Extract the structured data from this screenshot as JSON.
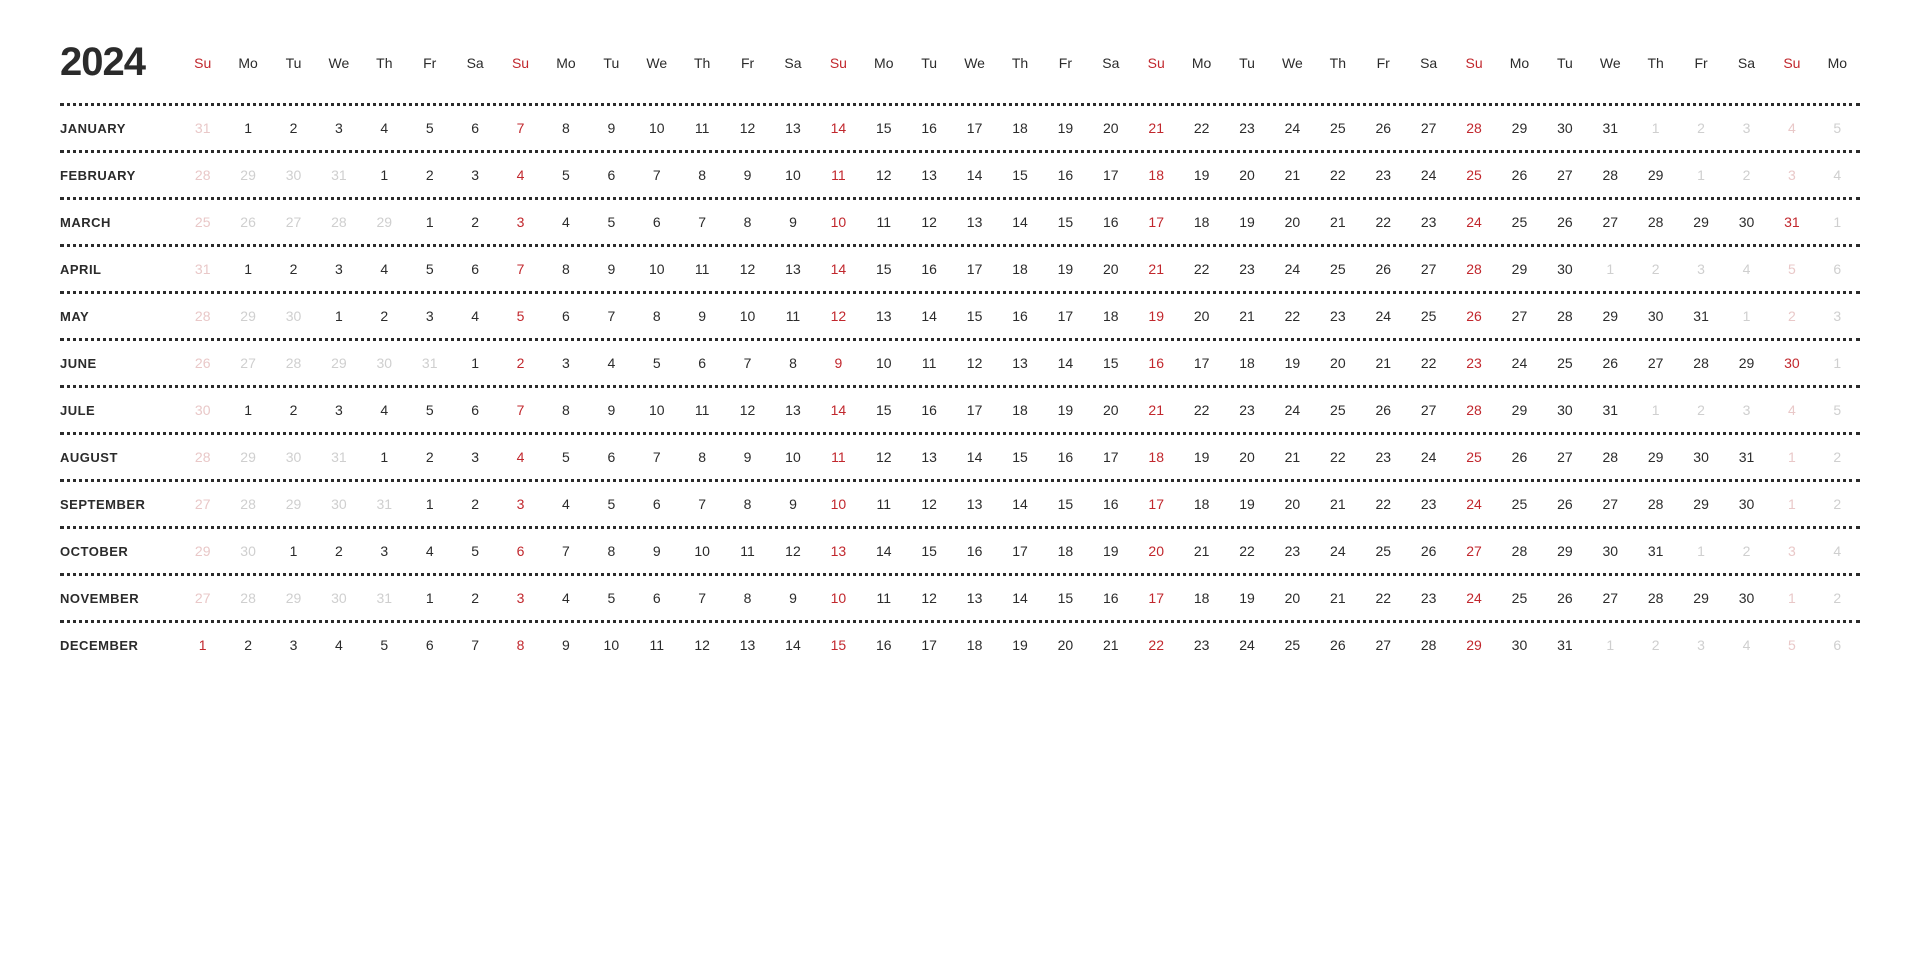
{
  "year": "2024",
  "weekday_pattern": [
    "Su",
    "Mo",
    "Tu",
    "We",
    "Th",
    "Fr",
    "Sa"
  ],
  "columns": 37,
  "months": [
    {
      "name": "JANUARY",
      "days": [
        {
          "n": 31,
          "f": 1
        },
        {
          "n": 1
        },
        {
          "n": 2
        },
        {
          "n": 3
        },
        {
          "n": 4
        },
        {
          "n": 5
        },
        {
          "n": 6
        },
        {
          "n": 7
        },
        {
          "n": 8
        },
        {
          "n": 9
        },
        {
          "n": 10
        },
        {
          "n": 11
        },
        {
          "n": 12
        },
        {
          "n": 13
        },
        {
          "n": 14
        },
        {
          "n": 15
        },
        {
          "n": 16
        },
        {
          "n": 17
        },
        {
          "n": 18
        },
        {
          "n": 19
        },
        {
          "n": 20
        },
        {
          "n": 21
        },
        {
          "n": 22
        },
        {
          "n": 23
        },
        {
          "n": 24
        },
        {
          "n": 25
        },
        {
          "n": 26
        },
        {
          "n": 27
        },
        {
          "n": 28
        },
        {
          "n": 29
        },
        {
          "n": 30
        },
        {
          "n": 31
        },
        {
          "n": 1,
          "f": 1
        },
        {
          "n": 2,
          "f": 1
        },
        {
          "n": 3,
          "f": 1
        },
        {
          "n": 4,
          "f": 1
        },
        {
          "n": 5,
          "f": 1
        }
      ]
    },
    {
      "name": "FEBRUARY",
      "days": [
        {
          "n": 28,
          "f": 1
        },
        {
          "n": 29,
          "f": 1
        },
        {
          "n": 30,
          "f": 1
        },
        {
          "n": 31,
          "f": 1
        },
        {
          "n": 1
        },
        {
          "n": 2
        },
        {
          "n": 3
        },
        {
          "n": 4
        },
        {
          "n": 5
        },
        {
          "n": 6
        },
        {
          "n": 7
        },
        {
          "n": 8
        },
        {
          "n": 9
        },
        {
          "n": 10
        },
        {
          "n": 11
        },
        {
          "n": 12
        },
        {
          "n": 13
        },
        {
          "n": 14
        },
        {
          "n": 15
        },
        {
          "n": 16
        },
        {
          "n": 17
        },
        {
          "n": 18
        },
        {
          "n": 19
        },
        {
          "n": 20
        },
        {
          "n": 21
        },
        {
          "n": 22
        },
        {
          "n": 23
        },
        {
          "n": 24
        },
        {
          "n": 25
        },
        {
          "n": 26
        },
        {
          "n": 27
        },
        {
          "n": 28
        },
        {
          "n": 29
        },
        {
          "n": 1,
          "f": 1
        },
        {
          "n": 2,
          "f": 1
        },
        {
          "n": 3,
          "f": 1
        },
        {
          "n": 4,
          "f": 1
        }
      ]
    },
    {
      "name": "MARCH",
      "days": [
        {
          "n": 25,
          "f": 1
        },
        {
          "n": 26,
          "f": 1
        },
        {
          "n": 27,
          "f": 1
        },
        {
          "n": 28,
          "f": 1
        },
        {
          "n": 29,
          "f": 1
        },
        {
          "n": 1
        },
        {
          "n": 2
        },
        {
          "n": 3
        },
        {
          "n": 4
        },
        {
          "n": 5
        },
        {
          "n": 6
        },
        {
          "n": 7
        },
        {
          "n": 8
        },
        {
          "n": 9
        },
        {
          "n": 10
        },
        {
          "n": 11
        },
        {
          "n": 12
        },
        {
          "n": 13
        },
        {
          "n": 14
        },
        {
          "n": 15
        },
        {
          "n": 16
        },
        {
          "n": 17
        },
        {
          "n": 18
        },
        {
          "n": 19
        },
        {
          "n": 20
        },
        {
          "n": 21
        },
        {
          "n": 22
        },
        {
          "n": 23
        },
        {
          "n": 24
        },
        {
          "n": 25
        },
        {
          "n": 26
        },
        {
          "n": 27
        },
        {
          "n": 28
        },
        {
          "n": 29
        },
        {
          "n": 30
        },
        {
          "n": 31
        },
        {
          "n": 1,
          "f": 1
        }
      ]
    },
    {
      "name": "APRIL",
      "days": [
        {
          "n": 31,
          "f": 1
        },
        {
          "n": 1
        },
        {
          "n": 2
        },
        {
          "n": 3
        },
        {
          "n": 4
        },
        {
          "n": 5
        },
        {
          "n": 6
        },
        {
          "n": 7
        },
        {
          "n": 8
        },
        {
          "n": 9
        },
        {
          "n": 10
        },
        {
          "n": 11
        },
        {
          "n": 12
        },
        {
          "n": 13
        },
        {
          "n": 14
        },
        {
          "n": 15
        },
        {
          "n": 16
        },
        {
          "n": 17
        },
        {
          "n": 18
        },
        {
          "n": 19
        },
        {
          "n": 20
        },
        {
          "n": 21
        },
        {
          "n": 22
        },
        {
          "n": 23
        },
        {
          "n": 24
        },
        {
          "n": 25
        },
        {
          "n": 26
        },
        {
          "n": 27
        },
        {
          "n": 28
        },
        {
          "n": 29
        },
        {
          "n": 30
        },
        {
          "n": 1,
          "f": 1
        },
        {
          "n": 2,
          "f": 1
        },
        {
          "n": 3,
          "f": 1
        },
        {
          "n": 4,
          "f": 1
        },
        {
          "n": 5,
          "f": 1
        },
        {
          "n": 6,
          "f": 1
        }
      ]
    },
    {
      "name": "MAY",
      "days": [
        {
          "n": 28,
          "f": 1
        },
        {
          "n": 29,
          "f": 1
        },
        {
          "n": 30,
          "f": 1
        },
        {
          "n": 1
        },
        {
          "n": 2
        },
        {
          "n": 3
        },
        {
          "n": 4
        },
        {
          "n": 5
        },
        {
          "n": 6
        },
        {
          "n": 7
        },
        {
          "n": 8
        },
        {
          "n": 9
        },
        {
          "n": 10
        },
        {
          "n": 11
        },
        {
          "n": 12
        },
        {
          "n": 13
        },
        {
          "n": 14
        },
        {
          "n": 15
        },
        {
          "n": 16
        },
        {
          "n": 17
        },
        {
          "n": 18
        },
        {
          "n": 19
        },
        {
          "n": 20
        },
        {
          "n": 21
        },
        {
          "n": 22
        },
        {
          "n": 23
        },
        {
          "n": 24
        },
        {
          "n": 25
        },
        {
          "n": 26
        },
        {
          "n": 27
        },
        {
          "n": 28
        },
        {
          "n": 29
        },
        {
          "n": 30
        },
        {
          "n": 31
        },
        {
          "n": 1,
          "f": 1
        },
        {
          "n": 2,
          "f": 1
        },
        {
          "n": 3,
          "f": 1
        }
      ]
    },
    {
      "name": "JUNE",
      "days": [
        {
          "n": 26,
          "f": 1
        },
        {
          "n": 27,
          "f": 1
        },
        {
          "n": 28,
          "f": 1
        },
        {
          "n": 29,
          "f": 1
        },
        {
          "n": 30,
          "f": 1
        },
        {
          "n": 31,
          "f": 1
        },
        {
          "n": 1
        },
        {
          "n": 2
        },
        {
          "n": 3
        },
        {
          "n": 4
        },
        {
          "n": 5
        },
        {
          "n": 6
        },
        {
          "n": 7
        },
        {
          "n": 8
        },
        {
          "n": 9
        },
        {
          "n": 10
        },
        {
          "n": 11
        },
        {
          "n": 12
        },
        {
          "n": 13
        },
        {
          "n": 14
        },
        {
          "n": 15
        },
        {
          "n": 16
        },
        {
          "n": 17
        },
        {
          "n": 18
        },
        {
          "n": 19
        },
        {
          "n": 20
        },
        {
          "n": 21
        },
        {
          "n": 22
        },
        {
          "n": 23
        },
        {
          "n": 24
        },
        {
          "n": 25
        },
        {
          "n": 26
        },
        {
          "n": 27
        },
        {
          "n": 28
        },
        {
          "n": 29
        },
        {
          "n": 30
        },
        {
          "n": 1,
          "f": 1
        }
      ]
    },
    {
      "name": "JULE",
      "days": [
        {
          "n": 30,
          "f": 1
        },
        {
          "n": 1
        },
        {
          "n": 2
        },
        {
          "n": 3
        },
        {
          "n": 4
        },
        {
          "n": 5
        },
        {
          "n": 6
        },
        {
          "n": 7
        },
        {
          "n": 8
        },
        {
          "n": 9
        },
        {
          "n": 10
        },
        {
          "n": 11
        },
        {
          "n": 12
        },
        {
          "n": 13
        },
        {
          "n": 14
        },
        {
          "n": 15
        },
        {
          "n": 16
        },
        {
          "n": 17
        },
        {
          "n": 18
        },
        {
          "n": 19
        },
        {
          "n": 20
        },
        {
          "n": 21
        },
        {
          "n": 22
        },
        {
          "n": 23
        },
        {
          "n": 24
        },
        {
          "n": 25
        },
        {
          "n": 26
        },
        {
          "n": 27
        },
        {
          "n": 28
        },
        {
          "n": 29
        },
        {
          "n": 30
        },
        {
          "n": 31
        },
        {
          "n": 1,
          "f": 1
        },
        {
          "n": 2,
          "f": 1
        },
        {
          "n": 3,
          "f": 1
        },
        {
          "n": 4,
          "f": 1
        },
        {
          "n": 5,
          "f": 1
        }
      ]
    },
    {
      "name": "AUGUST",
      "days": [
        {
          "n": 28,
          "f": 1
        },
        {
          "n": 29,
          "f": 1
        },
        {
          "n": 30,
          "f": 1
        },
        {
          "n": 31,
          "f": 1
        },
        {
          "n": 1
        },
        {
          "n": 2
        },
        {
          "n": 3
        },
        {
          "n": 4
        },
        {
          "n": 5
        },
        {
          "n": 6
        },
        {
          "n": 7
        },
        {
          "n": 8
        },
        {
          "n": 9
        },
        {
          "n": 10
        },
        {
          "n": 11
        },
        {
          "n": 12
        },
        {
          "n": 13
        },
        {
          "n": 14
        },
        {
          "n": 15
        },
        {
          "n": 16
        },
        {
          "n": 17
        },
        {
          "n": 18
        },
        {
          "n": 19
        },
        {
          "n": 20
        },
        {
          "n": 21
        },
        {
          "n": 22
        },
        {
          "n": 23
        },
        {
          "n": 24
        },
        {
          "n": 25
        },
        {
          "n": 26
        },
        {
          "n": 27
        },
        {
          "n": 28
        },
        {
          "n": 29
        },
        {
          "n": 30
        },
        {
          "n": 31
        },
        {
          "n": 1,
          "f": 1
        },
        {
          "n": 2,
          "f": 1
        }
      ]
    },
    {
      "name": "SEPTEMBER",
      "days": [
        {
          "n": 27,
          "f": 1
        },
        {
          "n": 28,
          "f": 1
        },
        {
          "n": 29,
          "f": 1
        },
        {
          "n": 30,
          "f": 1
        },
        {
          "n": 31,
          "f": 1
        },
        {
          "n": 1
        },
        {
          "n": 2
        },
        {
          "n": 3
        },
        {
          "n": 4
        },
        {
          "n": 5
        },
        {
          "n": 6
        },
        {
          "n": 7
        },
        {
          "n": 8
        },
        {
          "n": 9
        },
        {
          "n": 10
        },
        {
          "n": 11
        },
        {
          "n": 12
        },
        {
          "n": 13
        },
        {
          "n": 14
        },
        {
          "n": 15
        },
        {
          "n": 16
        },
        {
          "n": 17
        },
        {
          "n": 18
        },
        {
          "n": 19
        },
        {
          "n": 20
        },
        {
          "n": 21
        },
        {
          "n": 22
        },
        {
          "n": 23
        },
        {
          "n": 24
        },
        {
          "n": 25
        },
        {
          "n": 26
        },
        {
          "n": 27
        },
        {
          "n": 28
        },
        {
          "n": 29
        },
        {
          "n": 30
        },
        {
          "n": 1,
          "f": 1
        },
        {
          "n": 2,
          "f": 1
        }
      ]
    },
    {
      "name": "OCTOBER",
      "days": [
        {
          "n": 29,
          "f": 1
        },
        {
          "n": 30,
          "f": 1
        },
        {
          "n": 1
        },
        {
          "n": 2
        },
        {
          "n": 3
        },
        {
          "n": 4
        },
        {
          "n": 5
        },
        {
          "n": 6
        },
        {
          "n": 7
        },
        {
          "n": 8
        },
        {
          "n": 9
        },
        {
          "n": 10
        },
        {
          "n": 11
        },
        {
          "n": 12
        },
        {
          "n": 13
        },
        {
          "n": 14
        },
        {
          "n": 15
        },
        {
          "n": 16
        },
        {
          "n": 17
        },
        {
          "n": 18
        },
        {
          "n": 19
        },
        {
          "n": 20
        },
        {
          "n": 21
        },
        {
          "n": 22
        },
        {
          "n": 23
        },
        {
          "n": 24
        },
        {
          "n": 25
        },
        {
          "n": 26
        },
        {
          "n": 27
        },
        {
          "n": 28
        },
        {
          "n": 29
        },
        {
          "n": 30
        },
        {
          "n": 31
        },
        {
          "n": 1,
          "f": 1
        },
        {
          "n": 2,
          "f": 1
        },
        {
          "n": 3,
          "f": 1
        },
        {
          "n": 4,
          "f": 1
        }
      ]
    },
    {
      "name": "NOVEMBER",
      "days": [
        {
          "n": 27,
          "f": 1
        },
        {
          "n": 28,
          "f": 1
        },
        {
          "n": 29,
          "f": 1
        },
        {
          "n": 30,
          "f": 1
        },
        {
          "n": 31,
          "f": 1
        },
        {
          "n": 1
        },
        {
          "n": 2
        },
        {
          "n": 3
        },
        {
          "n": 4
        },
        {
          "n": 5
        },
        {
          "n": 6
        },
        {
          "n": 7
        },
        {
          "n": 8
        },
        {
          "n": 9
        },
        {
          "n": 10
        },
        {
          "n": 11
        },
        {
          "n": 12
        },
        {
          "n": 13
        },
        {
          "n": 14
        },
        {
          "n": 15
        },
        {
          "n": 16
        },
        {
          "n": 17
        },
        {
          "n": 18
        },
        {
          "n": 19
        },
        {
          "n": 20
        },
        {
          "n": 21
        },
        {
          "n": 22
        },
        {
          "n": 23
        },
        {
          "n": 24
        },
        {
          "n": 25
        },
        {
          "n": 26
        },
        {
          "n": 27
        },
        {
          "n": 28
        },
        {
          "n": 29
        },
        {
          "n": 30
        },
        {
          "n": 1,
          "f": 1
        },
        {
          "n": 2,
          "f": 1
        }
      ]
    },
    {
      "name": "DECEMBER",
      "days": [
        {
          "n": 1
        },
        {
          "n": 2
        },
        {
          "n": 3
        },
        {
          "n": 4
        },
        {
          "n": 5
        },
        {
          "n": 6
        },
        {
          "n": 7
        },
        {
          "n": 8
        },
        {
          "n": 9
        },
        {
          "n": 10
        },
        {
          "n": 11
        },
        {
          "n": 12
        },
        {
          "n": 13
        },
        {
          "n": 14
        },
        {
          "n": 15
        },
        {
          "n": 16
        },
        {
          "n": 17
        },
        {
          "n": 18
        },
        {
          "n": 19
        },
        {
          "n": 20
        },
        {
          "n": 21
        },
        {
          "n": 22
        },
        {
          "n": 23
        },
        {
          "n": 24
        },
        {
          "n": 25
        },
        {
          "n": 26
        },
        {
          "n": 27
        },
        {
          "n": 28
        },
        {
          "n": 29
        },
        {
          "n": 30
        },
        {
          "n": 31
        },
        {
          "n": 1,
          "f": 1
        },
        {
          "n": 2,
          "f": 1
        },
        {
          "n": 3,
          "f": 1
        },
        {
          "n": 4,
          "f": 1
        },
        {
          "n": 5,
          "f": 1
        },
        {
          "n": 6,
          "f": 1
        }
      ]
    }
  ]
}
